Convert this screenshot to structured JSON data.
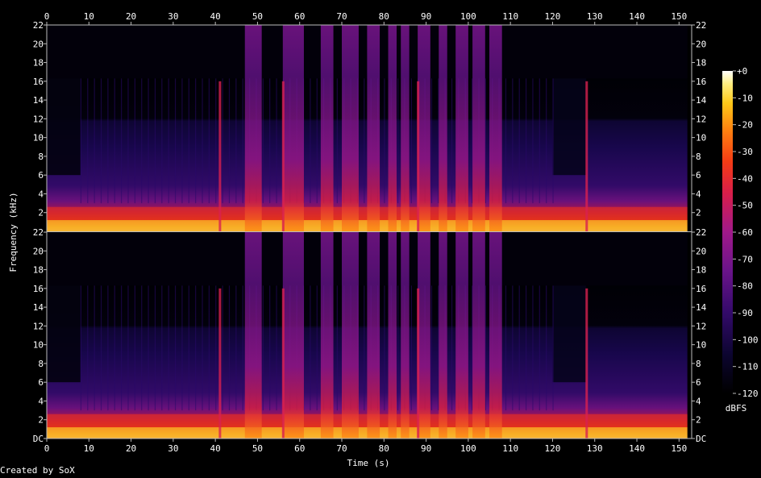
{
  "footer": "Created by SoX",
  "chart_data": {
    "type": "heatmap",
    "subtype": "spectrogram",
    "xlabel": "Time (s)",
    "ylabel": "Frequency (kHz)",
    "xlim": [
      0,
      153
    ],
    "ylim": [
      0,
      22
    ],
    "x_ticks": [
      "0",
      "10",
      "20",
      "30",
      "40",
      "50",
      "60",
      "70",
      "80",
      "90",
      "100",
      "110",
      "120",
      "130",
      "140",
      "150"
    ],
    "y_ticks_bottom": [
      "DC",
      "2",
      "4",
      "6",
      "8",
      "10",
      "12",
      "14",
      "16",
      "18",
      "20",
      "22"
    ],
    "y_ticks_top": [
      "2",
      "4",
      "6",
      "8",
      "10",
      "12",
      "14",
      "16",
      "18",
      "20",
      "22"
    ],
    "channels": 2,
    "colorbar": {
      "label": "dBFS",
      "range": [
        -120,
        0
      ],
      "ticks": [
        "+0",
        "-10",
        "-20",
        "-30",
        "-40",
        "-50",
        "-60",
        "-70",
        "-80",
        "-90",
        "-100",
        "-110",
        "-120"
      ]
    },
    "features": {
      "low_band_rise_s": 8,
      "bandlimit_16k_span_s": [
        8,
        120
      ],
      "transients_s": [
        41,
        56,
        88,
        128
      ],
      "fullband_bursts_s": [
        [
          47,
          51
        ],
        [
          56,
          61
        ],
        [
          65,
          68
        ],
        [
          70,
          74
        ],
        [
          76,
          79
        ],
        [
          81,
          83
        ],
        [
          84,
          86
        ],
        [
          88,
          91
        ],
        [
          93,
          95
        ],
        [
          97,
          100
        ],
        [
          101,
          104
        ],
        [
          105,
          108
        ]
      ],
      "fade_end_s": 152
    }
  }
}
